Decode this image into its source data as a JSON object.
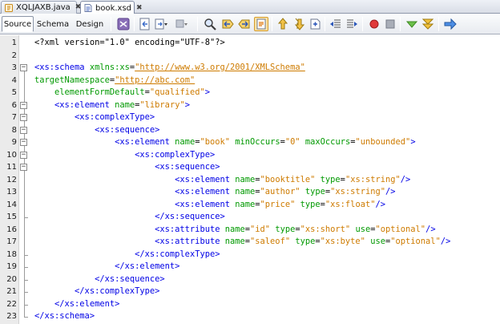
{
  "file_tabs": [
    {
      "name": "XQLJAXB.java",
      "close": "✖",
      "active": false,
      "icon": "java-file-icon"
    },
    {
      "name": "book.xsd",
      "close": "✖",
      "active": true,
      "icon": "xsd-file-icon"
    }
  ],
  "view_tabs": [
    "Source",
    "Schema",
    "Design"
  ],
  "toolbar_icons": [
    "validate-xml-icon",
    "back-icon",
    "history-icon",
    "bookmark-icon",
    "find-icon",
    "find-previous-icon",
    "find-next-icon",
    "toggle-highlight-icon",
    "previous-bookmark-icon",
    "next-bookmark-icon",
    "toggle-bookmark-icon",
    "shift-left-icon",
    "shift-right-icon",
    "start-macro-icon",
    "stop-macro-icon",
    "check-xml-icon",
    "validate-icon",
    "xsl-transform-icon"
  ],
  "line_numbers": [
    "1",
    "2",
    "3",
    "4",
    "5",
    "6",
    "7",
    "8",
    "9",
    "10",
    "11",
    "12",
    "13",
    "14",
    "15",
    "16",
    "17",
    "18",
    "19",
    "20",
    "21",
    "22",
    "23"
  ],
  "fold_glyph": "−",
  "lines": [
    [
      [
        "pi",
        "<?xml version=\"1.0\" encoding=\"UTF-8\"?>"
      ]
    ],
    [],
    [
      [
        "tag",
        "<xs:schema "
      ],
      [
        "attr",
        "xmlns:xs"
      ],
      [
        "plain",
        "="
      ],
      [
        "url",
        "\"http://www.w3.org/2001/XMLSchema\""
      ]
    ],
    [
      [
        "attr",
        "targetNamespace"
      ],
      [
        "plain",
        "="
      ],
      [
        "url",
        "\"http://abc.com\""
      ]
    ],
    [
      [
        "plain",
        "    "
      ],
      [
        "attr",
        "elementFormDefault"
      ],
      [
        "plain",
        "="
      ],
      [
        "val",
        "\"qualified\""
      ],
      [
        "tag",
        ">"
      ]
    ],
    [
      [
        "plain",
        "    "
      ],
      [
        "tag",
        "<xs:element "
      ],
      [
        "attr",
        "name"
      ],
      [
        "plain",
        "="
      ],
      [
        "val",
        "\"library\""
      ],
      [
        "tag",
        ">"
      ]
    ],
    [
      [
        "plain",
        "        "
      ],
      [
        "tag",
        "<xs:complexType>"
      ]
    ],
    [
      [
        "plain",
        "            "
      ],
      [
        "tag",
        "<xs:sequence>"
      ]
    ],
    [
      [
        "plain",
        "                "
      ],
      [
        "tag",
        "<xs:element "
      ],
      [
        "attr",
        "name"
      ],
      [
        "plain",
        "="
      ],
      [
        "val",
        "\"book\""
      ],
      [
        "plain",
        " "
      ],
      [
        "attr",
        "minOccurs"
      ],
      [
        "plain",
        "="
      ],
      [
        "val",
        "\"0\""
      ],
      [
        "plain",
        " "
      ],
      [
        "attr",
        "maxOccurs"
      ],
      [
        "plain",
        "="
      ],
      [
        "val",
        "\"unbounded\""
      ],
      [
        "tag",
        ">"
      ]
    ],
    [
      [
        "plain",
        "                    "
      ],
      [
        "tag",
        "<xs:complexType>"
      ]
    ],
    [
      [
        "plain",
        "                        "
      ],
      [
        "tag",
        "<xs:sequence>"
      ]
    ],
    [
      [
        "plain",
        "                            "
      ],
      [
        "tag",
        "<xs:element "
      ],
      [
        "attr",
        "name"
      ],
      [
        "plain",
        "="
      ],
      [
        "val",
        "\"booktitle\""
      ],
      [
        "plain",
        " "
      ],
      [
        "attr",
        "type"
      ],
      [
        "plain",
        "="
      ],
      [
        "val",
        "\"xs:string\""
      ],
      [
        "tag",
        "/>"
      ]
    ],
    [
      [
        "plain",
        "                            "
      ],
      [
        "tag",
        "<xs:element "
      ],
      [
        "attr",
        "name"
      ],
      [
        "plain",
        "="
      ],
      [
        "val",
        "\"author\""
      ],
      [
        "plain",
        " "
      ],
      [
        "attr",
        "type"
      ],
      [
        "plain",
        "="
      ],
      [
        "val",
        "\"xs:string\""
      ],
      [
        "tag",
        "/>"
      ]
    ],
    [
      [
        "plain",
        "                            "
      ],
      [
        "tag",
        "<xs:element "
      ],
      [
        "attr",
        "name"
      ],
      [
        "plain",
        "="
      ],
      [
        "val",
        "\"price\""
      ],
      [
        "plain",
        " "
      ],
      [
        "attr",
        "type"
      ],
      [
        "plain",
        "="
      ],
      [
        "val",
        "\"xs:float\""
      ],
      [
        "tag",
        "/>"
      ]
    ],
    [
      [
        "plain",
        "                        "
      ],
      [
        "tag",
        "</xs:sequence>"
      ]
    ],
    [
      [
        "plain",
        "                        "
      ],
      [
        "tag",
        "<xs:attribute "
      ],
      [
        "attr",
        "name"
      ],
      [
        "plain",
        "="
      ],
      [
        "val",
        "\"id\""
      ],
      [
        "plain",
        " "
      ],
      [
        "attr",
        "type"
      ],
      [
        "plain",
        "="
      ],
      [
        "val",
        "\"xs:short\""
      ],
      [
        "plain",
        " "
      ],
      [
        "attr",
        "use"
      ],
      [
        "plain",
        "="
      ],
      [
        "val",
        "\"optional\""
      ],
      [
        "tag",
        "/>"
      ]
    ],
    [
      [
        "plain",
        "                        "
      ],
      [
        "tag",
        "<xs:attribute "
      ],
      [
        "attr",
        "name"
      ],
      [
        "plain",
        "="
      ],
      [
        "val",
        "\"saleof\""
      ],
      [
        "plain",
        " "
      ],
      [
        "attr",
        "type"
      ],
      [
        "plain",
        "="
      ],
      [
        "val",
        "\"xs:byte\""
      ],
      [
        "plain",
        " "
      ],
      [
        "attr",
        "use"
      ],
      [
        "plain",
        "="
      ],
      [
        "val",
        "\"optional\""
      ],
      [
        "tag",
        "/>"
      ]
    ],
    [
      [
        "plain",
        "                    "
      ],
      [
        "tag",
        "</xs:complexType>"
      ]
    ],
    [
      [
        "plain",
        "                "
      ],
      [
        "tag",
        "</xs:element>"
      ]
    ],
    [
      [
        "plain",
        "            "
      ],
      [
        "tag",
        "</xs:sequence>"
      ]
    ],
    [
      [
        "plain",
        "        "
      ],
      [
        "tag",
        "</xs:complexType>"
      ]
    ],
    [
      [
        "plain",
        "    "
      ],
      [
        "tag",
        "</xs:element>"
      ]
    ],
    [
      [
        "tag",
        "</xs:schema>"
      ]
    ]
  ],
  "fold_starts": [
    3,
    6,
    7,
    8,
    9,
    10,
    11
  ],
  "fold_ends": [
    15,
    18,
    19,
    20,
    21,
    22,
    23
  ],
  "colors": {
    "tag": "#0000e6",
    "attribute": "#009900",
    "value": "#ce7b00",
    "gutter": "#ebebeb",
    "toolbar": "#e8ebf0"
  }
}
